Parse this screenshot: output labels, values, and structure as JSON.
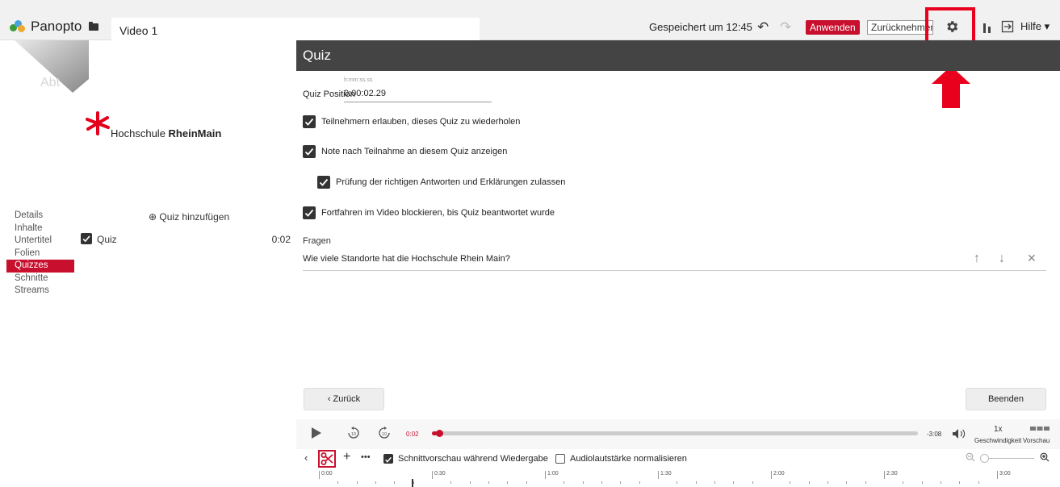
{
  "header": {
    "app_name": "Panopto",
    "video_title": "Video 1",
    "saved_text": "Gespeichert um 12:45",
    "apply_label": "Anwenden",
    "revert_label": "Zurücknehmen",
    "help_label": "Hilfe",
    "undo_icon": "↶",
    "redo_icon": "↷"
  },
  "preview": {
    "fragment_text": "Abt",
    "org_name_regular": "Hochschule ",
    "org_name_bold": "RheinMain"
  },
  "nav": {
    "items": [
      {
        "label": "Details",
        "active": false
      },
      {
        "label": "Inhalte",
        "active": false
      },
      {
        "label": "Untertitel",
        "active": false
      },
      {
        "label": "Folien",
        "active": false
      },
      {
        "label": "Quizzes",
        "active": true
      },
      {
        "label": "Schnitte",
        "active": false
      },
      {
        "label": "Streams",
        "active": false
      }
    ]
  },
  "quiz_list": {
    "add_label": "⊕ Quiz hinzufügen",
    "items": [
      {
        "label": "Quiz",
        "time": "0:02",
        "checked": true
      }
    ]
  },
  "quiz_panel": {
    "title": "Quiz",
    "position_format": "h:mm:ss.ss",
    "position_label": "Quiz Position",
    "position_value": "0:00:02.29",
    "options": [
      {
        "label": "Teilnehmern erlauben, dieses Quiz zu wiederholen",
        "checked": true
      },
      {
        "label": "Note nach Teilnahme an diesem Quiz anzeigen",
        "checked": true
      },
      {
        "label": "Prüfung der richtigen Antworten und Erklärungen zulassen",
        "checked": true
      },
      {
        "label": "Fortfahren im Video blockieren, bis Quiz beantwortet wurde",
        "checked": true
      }
    ],
    "questions_label": "Fragen",
    "questions": [
      {
        "text": "Wie viele Standorte hat die Hochschule Rhein Main?"
      }
    ],
    "move_up_icon": "↑",
    "move_down_icon": "↓",
    "remove_icon": "✕",
    "back_label": "‹  Zurück",
    "finish_label": "Beenden"
  },
  "player": {
    "current_time": "0:02",
    "remaining_time": "-3:08",
    "progress_fraction": 0.011,
    "speed_value": "1x",
    "speed_label": "Geschwindigkeit",
    "preview_label": "Vorschau",
    "skip_back_label": "10",
    "skip_forward_label": "10"
  },
  "edit_toolbar": {
    "back_icon": "‹",
    "add_icon": "+",
    "more_icon": "•••",
    "cut_preview_label": "Schnittvorschau während Wiedergabe",
    "cut_preview_checked": true,
    "normalize_label": "Audiolautstärke normalisieren",
    "normalize_checked": false,
    "zoom_out_icon": "🔍",
    "zoom_in_icon": "🔍"
  },
  "timeline": {
    "ticks": [
      "0:00",
      "0:30",
      "1:00",
      "1:30",
      "2:00",
      "2:30",
      "3:00"
    ]
  },
  "colors": {
    "accent": "#c8102e",
    "header_dark": "#444444",
    "highlight": "#e8001c"
  }
}
